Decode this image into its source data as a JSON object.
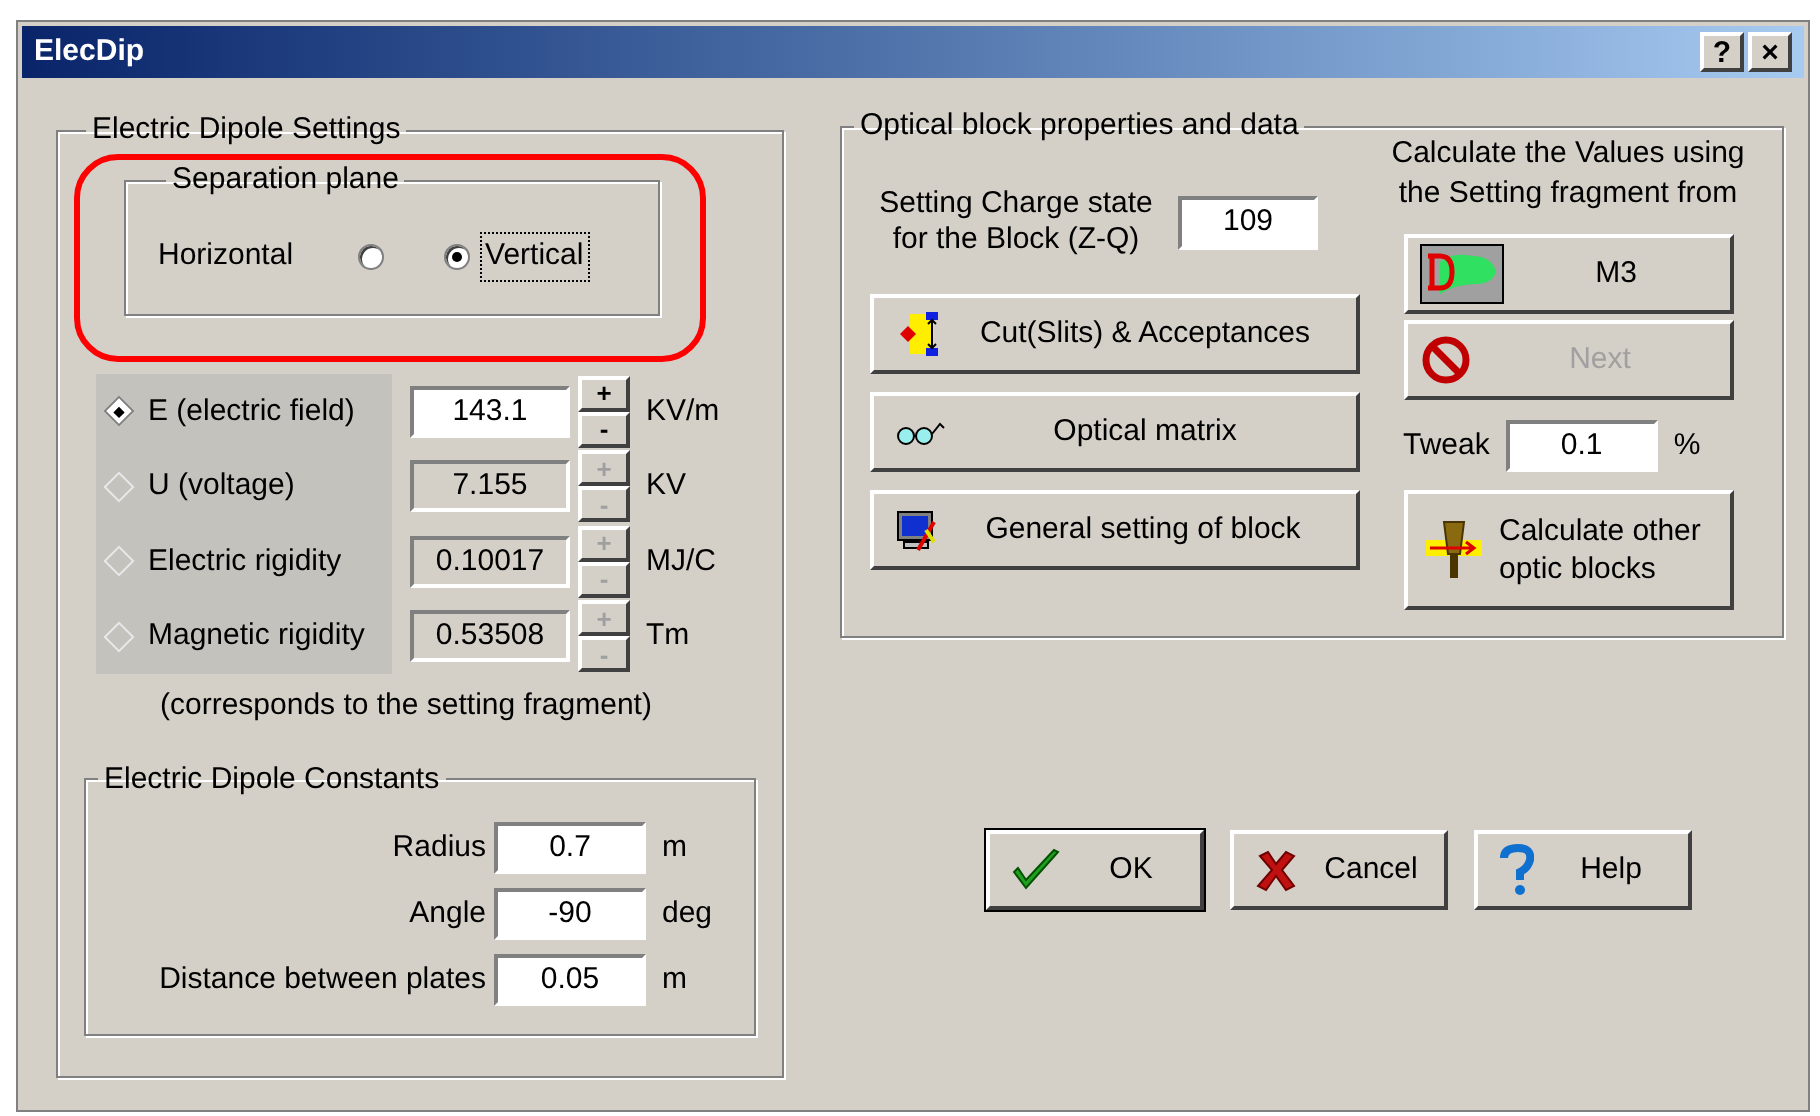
{
  "window": {
    "title": "ElecDip",
    "title_buttons": [
      "?",
      "×"
    ]
  },
  "dipole_settings": {
    "title": "Electric Dipole Settings",
    "separation_plane": {
      "title": "Separation plane",
      "highlighted": true,
      "options": [
        {
          "label": "Horizontal",
          "selected": false
        },
        {
          "label": "Vertical",
          "selected": true
        }
      ]
    },
    "parameters": [
      {
        "label": "E (electric field)",
        "value": "143.1",
        "unit": "KV/m",
        "selected": true
      },
      {
        "label": "U (voltage)",
        "value": "7.155",
        "unit": "KV",
        "selected": false
      },
      {
        "label": "Electric rigidity",
        "value": "0.10017",
        "unit": "MJ/C",
        "selected": false
      },
      {
        "label": "Magnetic rigidity",
        "value": "0.53508",
        "unit": "Tm",
        "selected": false
      }
    ],
    "spin_labels": [
      "+",
      "-"
    ],
    "note": "(corresponds to the setting fragment)"
  },
  "constants": {
    "title": "Electric Dipole Constants",
    "fields": [
      {
        "label": "Radius",
        "value": "0.7",
        "unit": "m"
      },
      {
        "label": "Angle",
        "value": "-90",
        "unit": "deg"
      },
      {
        "label": "Distance between plates",
        "value": "0.05",
        "unit": "m"
      }
    ]
  },
  "optical_block": {
    "title": "Optical block properties and data",
    "charge_state": {
      "label": "Setting Charge state for the Block (Z-Q)",
      "value": "109"
    },
    "buttons": [
      {
        "kind": "slits",
        "label": "Cut(Slits) & Acceptances"
      },
      {
        "kind": "glasses",
        "label": "Optical matrix"
      },
      {
        "kind": "monitor",
        "label": "General setting of block"
      }
    ],
    "calculate_title": "Calculate the Values using the Setting fragment from",
    "fragment_buttons": [
      {
        "kind": "magnet",
        "label": "M3",
        "disabled": false
      },
      {
        "kind": "stop",
        "label": "Next",
        "disabled": true
      }
    ],
    "tweak": {
      "label": "Tweak",
      "value": "0.1",
      "unit": "%"
    },
    "calculate_other": {
      "label": "Calculate other optic blocks"
    }
  },
  "dialog_buttons": [
    {
      "kind": "ok",
      "label": "OK",
      "default": true
    },
    {
      "kind": "cancel",
      "label": "Cancel",
      "default": false
    },
    {
      "kind": "help",
      "label": "Help",
      "default": false
    }
  ]
}
